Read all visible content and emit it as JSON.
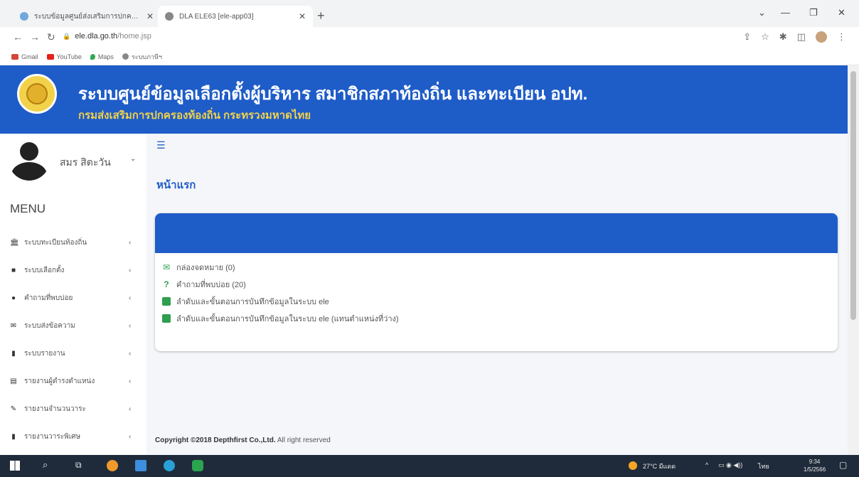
{
  "browser": {
    "tabs": [
      {
        "title": "ระบบข้อมูลศูนย์ส่งเสริมการปกครอง...",
        "active": false
      },
      {
        "title": "DLA ELE63 [ele-app03]",
        "active": true
      }
    ],
    "url_domain": "ele.dla.go.th",
    "url_path": "/home.jsp",
    "bookmarks": [
      "Gmail",
      "YouTube",
      "Maps",
      "ระบบภาษีฯ"
    ]
  },
  "header": {
    "title": "ระบบศูนย์ข้อมูลเลือกตั้งผู้บริหาร สมาชิกสภาท้องถิ่น และทะเบียน อปท.",
    "subtitle": "กรมส่งเสริมการปกครองท้องถิ่น กระทรวงมหาดไทย"
  },
  "sidebar": {
    "username": "สมร สิตะวัน",
    "menu_title": "MENU",
    "items": [
      {
        "label": "ระบบทะเบียนท้องถิ่น",
        "icon": "bank-icon"
      },
      {
        "label": "ระบบเลือกตั้ง",
        "icon": "briefcase-icon"
      },
      {
        "label": "คำถามที่พบบ่อย",
        "icon": "question-circle-icon"
      },
      {
        "label": "ระบบส่งข้อความ",
        "icon": "envelope-icon"
      },
      {
        "label": "ระบบรายงาน",
        "icon": "file-icon"
      },
      {
        "label": "รายงานผู้ดำรงตำแหน่ง",
        "icon": "file-text-icon"
      },
      {
        "label": "รายงานจำนวนวาระ",
        "icon": "edit-icon"
      },
      {
        "label": "รายงานวาระพิเศษ",
        "icon": "file-icon"
      }
    ]
  },
  "main": {
    "page_title": "หน้าแรก",
    "links": [
      {
        "label": "กล่องจดหมาย (0)",
        "icon": "inbox-icon"
      },
      {
        "label": "คำถามที่พบบ่อย (20)",
        "icon": "question-icon"
      },
      {
        "label": "ลำดับและขั้นตอนการบันทึกข้อมูลในระบบ ele",
        "icon": "book-icon"
      },
      {
        "label": "ลำดับและขั้นตอนการบันทึกข้อมูลในระบบ ele (แทนตำแหน่งที่ว่าง)",
        "icon": "book-icon"
      }
    ],
    "footer_bold": "Copyright ©2018 Depthfirst Co.,Ltd.",
    "footer_rest": " All right reserved"
  },
  "taskbar": {
    "weather": "27°C มีแดด",
    "lang": "ไทย",
    "time": "9:34",
    "date": "1/5/2566"
  },
  "colors": {
    "primary": "#1e5cc8",
    "header_subtitle": "#f2d24a",
    "main_bg": "#f4f6f9",
    "taskbar": "#1f2b3a"
  }
}
